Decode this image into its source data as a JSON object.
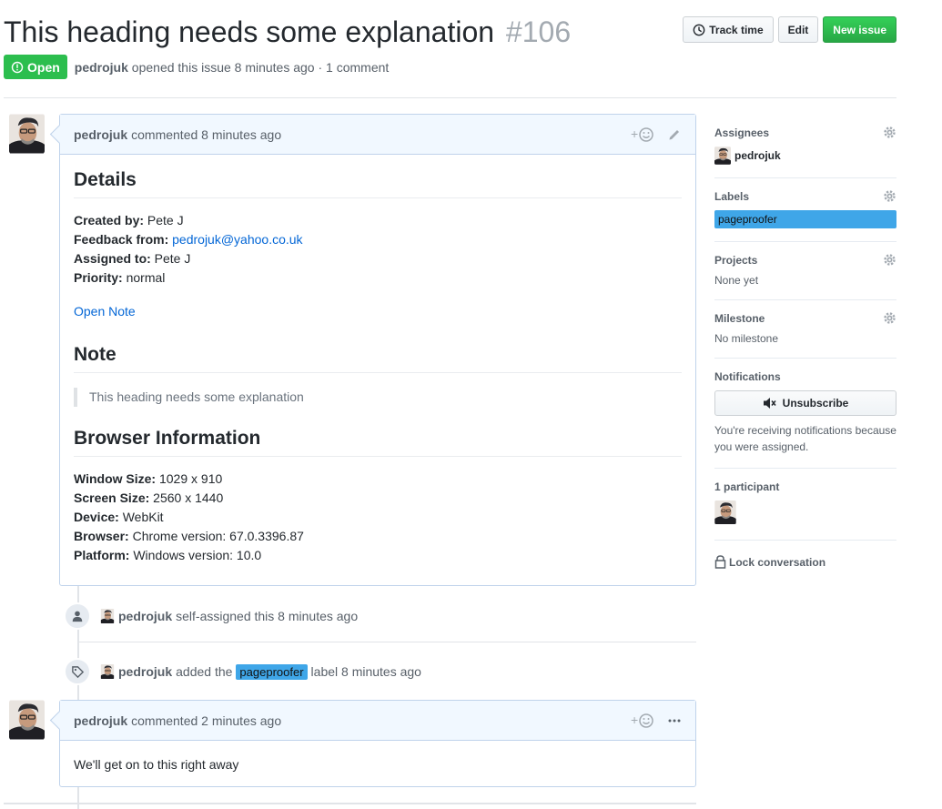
{
  "issue": {
    "title": "This heading needs some explanation",
    "number": "#106",
    "state": "Open",
    "author": "pedrojuk",
    "opened_text": "opened this issue 8 minutes ago · 1 comment"
  },
  "header_actions": {
    "track_time": "Track time",
    "edit": "Edit",
    "new_issue": "New issue"
  },
  "first_comment": {
    "author": "pedrojuk",
    "time_text": "commented 8 minutes ago",
    "details_heading": "Details",
    "created_by_label": "Created by:",
    "created_by_value": "Pete J",
    "feedback_from_label": "Feedback from:",
    "feedback_from_value": "pedrojuk@yahoo.co.uk",
    "assigned_to_label": "Assigned to:",
    "assigned_to_value": "Pete J",
    "priority_label": "Priority:",
    "priority_value": "normal",
    "open_note_link": "Open Note",
    "note_heading": "Note",
    "note_text": "This heading needs some explanation",
    "browser_heading": "Browser Information",
    "window_size_label": "Window Size:",
    "window_size_value": "1029 x 910",
    "screen_size_label": "Screen Size:",
    "screen_size_value": "2560 x 1440",
    "device_label": "Device:",
    "device_value": "WebKit",
    "browser_label": "Browser:",
    "browser_value": "Chrome version: 67.0.3396.87",
    "platform_label": "Platform:",
    "platform_value": "Windows version: 10.0"
  },
  "events": {
    "assigned": {
      "author": "pedrojuk",
      "text": "self-assigned this 8 minutes ago"
    },
    "labeled": {
      "author": "pedrojuk",
      "before": "added the",
      "label": "pageproofer",
      "after": "label 8 minutes ago"
    }
  },
  "second_comment": {
    "author": "pedrojuk",
    "time_text": "commented 2 minutes ago",
    "body": "We'll get on to this right away"
  },
  "sidebar": {
    "assignees_heading": "Assignees",
    "assignee": "pedrojuk",
    "labels_heading": "Labels",
    "label": "pageproofer",
    "projects_heading": "Projects",
    "projects_value": "None yet",
    "milestone_heading": "Milestone",
    "milestone_value": "No milestone",
    "notifications_heading": "Notifications",
    "unsubscribe_label": "Unsubscribe",
    "notifications_reason": "You're receiving notifications because you were assigned.",
    "participants_heading": "1 participant",
    "lock_label": "Lock conversation"
  },
  "colors": {
    "open_badge": "#2cbe4e",
    "primary_button": "#28a745",
    "label": "#3fa6e8",
    "link": "#0366d6",
    "comment_header": "#f1f8ff"
  },
  "icons": [
    "clock-icon",
    "issue-opened-icon",
    "add-reaction-icon",
    "pencil-icon",
    "kebab-icon",
    "person-icon",
    "tag-icon",
    "gear-icon",
    "mute-icon",
    "lock-icon"
  ]
}
